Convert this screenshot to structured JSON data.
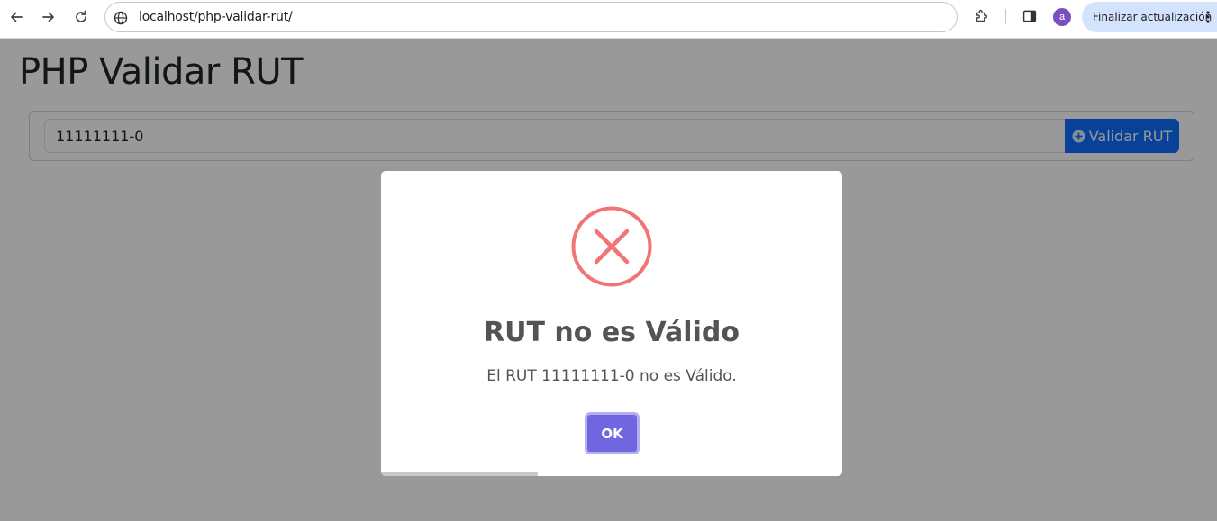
{
  "browser": {
    "url": "localhost/php-validar-rut/",
    "profile_initial": "a",
    "update_label": "Finalizar actualización"
  },
  "page": {
    "title": "PHP Validar RUT",
    "rut_input_value": "11111111-0",
    "validate_button_label": "Validar RUT"
  },
  "modal": {
    "icon": "error-x-icon",
    "title": "RUT no es Válido",
    "text": "El RUT 11111111-0 no es Válido.",
    "ok_label": "OK",
    "timer_progress": 0.34
  },
  "colors": {
    "primary": "#0d6efd",
    "error": "#f27474",
    "confirm": "#7066e0",
    "overlay": "rgba(0,0,0,0.4)"
  }
}
